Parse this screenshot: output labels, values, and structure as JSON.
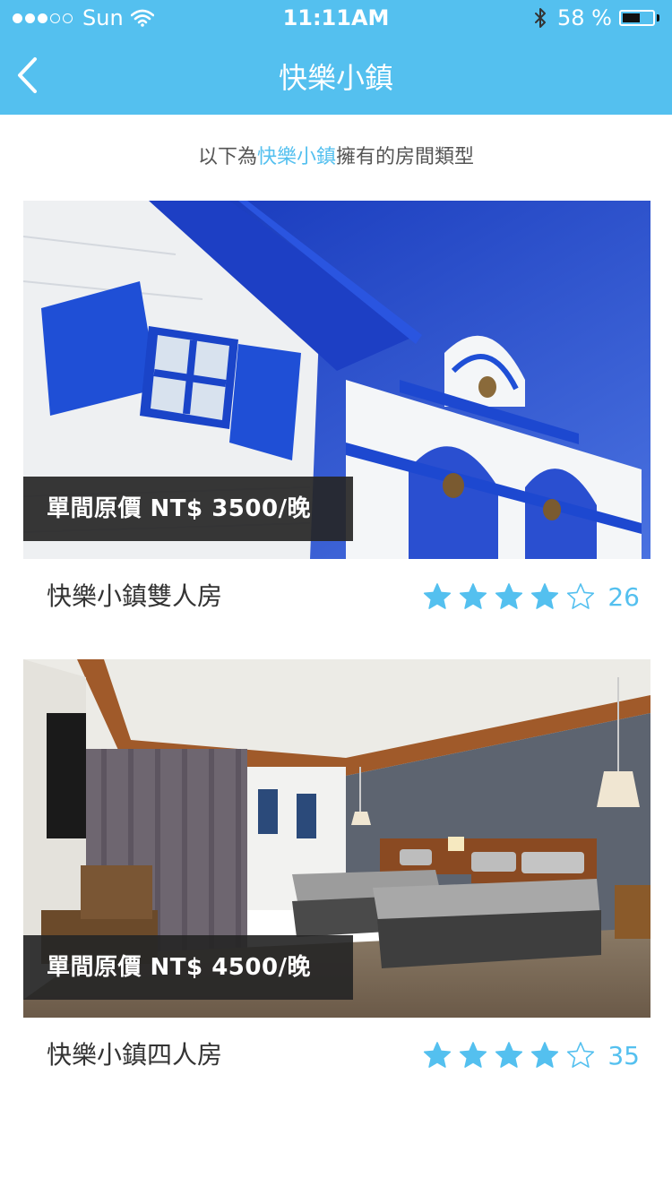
{
  "status_bar": {
    "carrier": "Sun",
    "time": "11:11AM",
    "battery": "58 %",
    "battery_level": 0.58,
    "signal_bars": 3,
    "signal_total": 5
  },
  "nav": {
    "title": "快樂小鎮",
    "back_icon": "chevron-left-icon"
  },
  "intro": {
    "prefix": "以下為",
    "highlight": "快樂小鎮",
    "suffix": "擁有的房間類型"
  },
  "colors": {
    "accent": "#54c0ef",
    "price_tag_bg": "#262626"
  },
  "rooms": [
    {
      "price_label": "單間原價 NT$ 3500/晚",
      "name": "快樂小鎮雙人房",
      "rating": 4,
      "max_rating": 5,
      "reviews": "26"
    },
    {
      "price_label": "單間原價 NT$ 4500/晚",
      "name": "快樂小鎮四人房",
      "rating": 4,
      "max_rating": 5,
      "reviews": "35"
    }
  ]
}
